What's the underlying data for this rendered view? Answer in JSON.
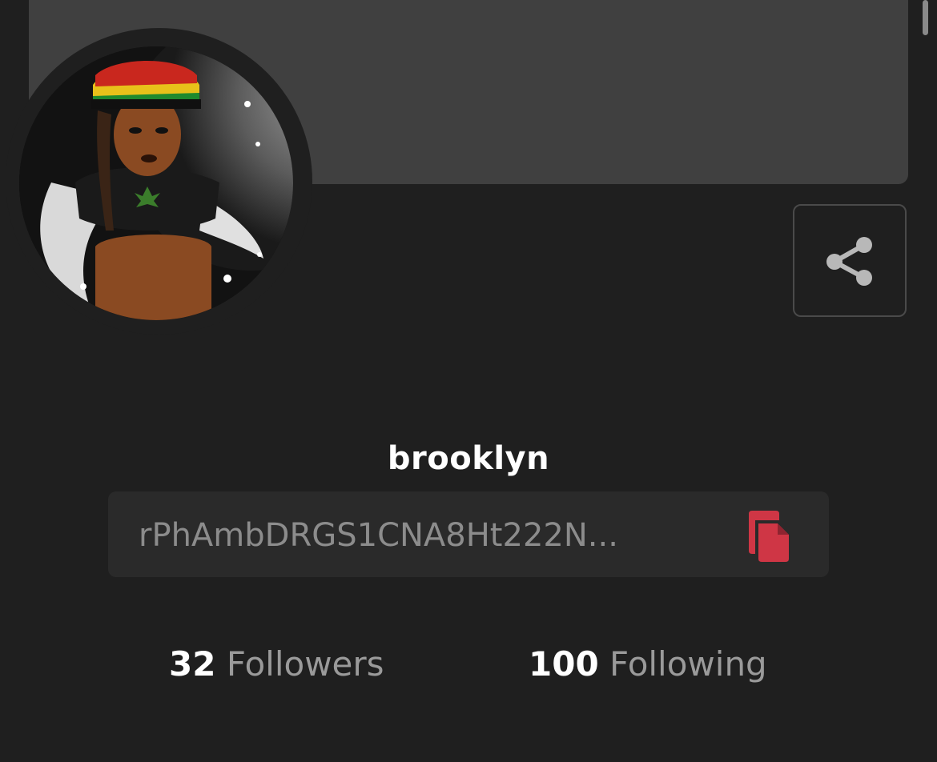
{
  "profile": {
    "username": "brooklyn",
    "address": "rPhAmbDRGS1CNA8Ht222N...",
    "followers_count": "32",
    "followers_label": "Followers",
    "following_count": "100",
    "following_label": "Following"
  },
  "icons": {
    "share": "share-icon",
    "copy": "copy-icon"
  },
  "colors": {
    "background": "#1f1f1f",
    "banner": "#404040",
    "accent_copy": "#cf3645"
  }
}
